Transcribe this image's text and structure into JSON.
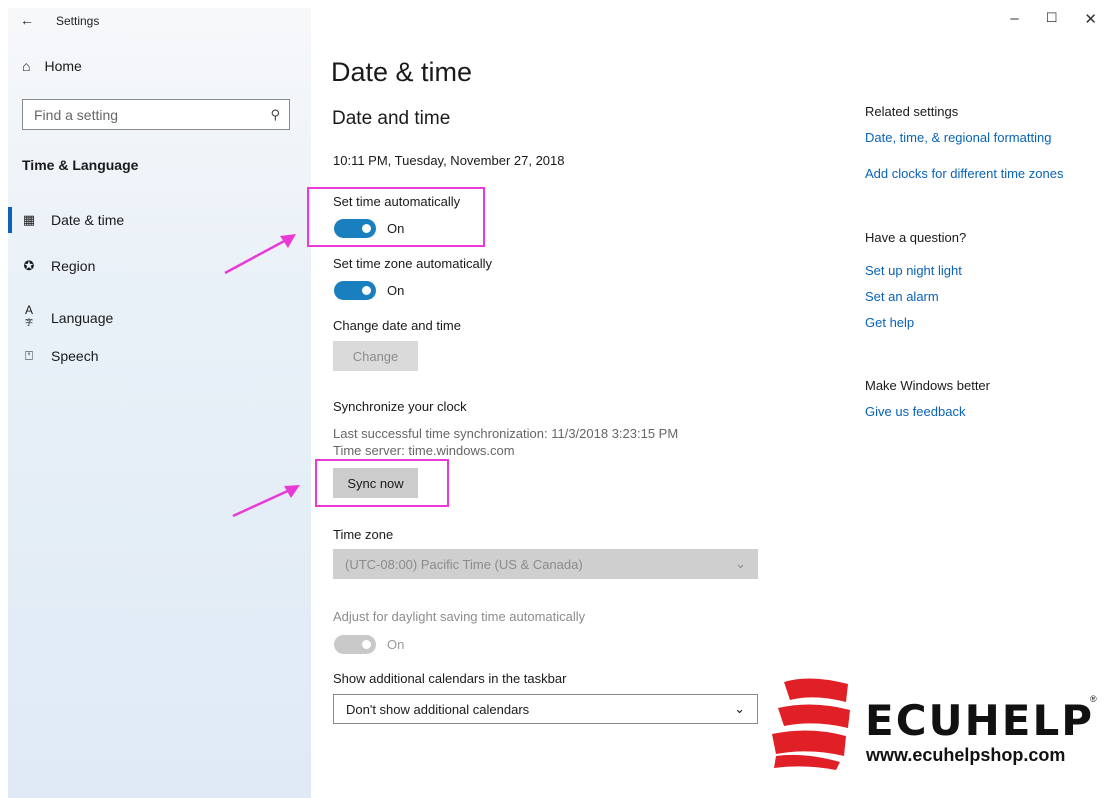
{
  "titlebar": {
    "back_icon": "arrow-left-icon",
    "title": "Settings"
  },
  "window_controls": {
    "minimize": "–",
    "maximize": "☐",
    "close": "✕"
  },
  "sidebar": {
    "home_label": "Home",
    "search_placeholder": "Find a setting",
    "section": "Time & Language",
    "items": [
      {
        "label": "Date & time",
        "icon": "calendar-clock-icon",
        "active": true
      },
      {
        "label": "Region",
        "icon": "globe-icon",
        "active": false
      },
      {
        "label": "Language",
        "icon": "language-icon",
        "active": false
      },
      {
        "label": "Speech",
        "icon": "microphone-icon",
        "active": false
      }
    ]
  },
  "main": {
    "page_title": "Date & time",
    "section_title": "Date and time",
    "current_datetime": "10:11 PM, Tuesday, November 27, 2018",
    "set_time_auto": {
      "label": "Set time automatically",
      "state": "On"
    },
    "set_zone_auto": {
      "label": "Set time zone automatically",
      "state": "On"
    },
    "change_date": {
      "label": "Change date and time",
      "button": "Change"
    },
    "sync": {
      "heading": "Synchronize your clock",
      "last_sync": "Last successful time synchronization: 11/3/2018 3:23:15 PM",
      "server": "Time server: time.windows.com",
      "button": "Sync now"
    },
    "timezone": {
      "label": "Time zone",
      "value": "(UTC-08:00) Pacific Time (US & Canada)"
    },
    "dst": {
      "label": "Adjust for daylight saving time automatically",
      "state": "On"
    },
    "calendars": {
      "label": "Show additional calendars in the taskbar",
      "value": "Don't show additional calendars"
    }
  },
  "related": {
    "heading": "Related settings",
    "links": [
      "Date, time, & regional formatting",
      "Add clocks for different time zones"
    ],
    "question_heading": "Have a question?",
    "question_links": [
      "Set up night light",
      "Set an alarm",
      "Get help"
    ],
    "better_heading": "Make Windows better",
    "feedback_link": "Give us feedback"
  },
  "watermark": {
    "name": "ECUHELP",
    "url": "www.ecuhelpshop.com",
    "reg": "®"
  },
  "colors": {
    "accent": "#1a7fbe",
    "link": "#0a63b8",
    "highlight": "#e83ad6",
    "logo_red": "#e01f26"
  }
}
